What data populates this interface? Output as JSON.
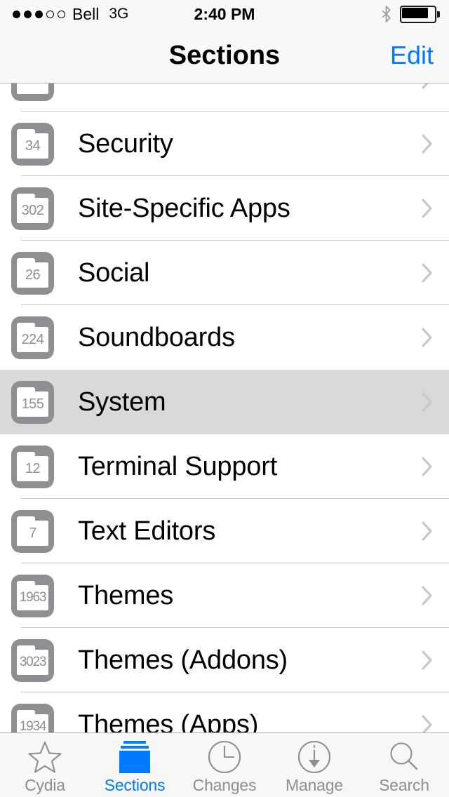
{
  "status_bar": {
    "signal_dots_filled": 3,
    "signal_dots_total": 5,
    "carrier": "Bell",
    "network": "3G",
    "time": "2:40 PM",
    "bluetooth_icon": "bluetooth-icon",
    "battery_icon": "battery-icon",
    "battery_level_percent": 80
  },
  "nav_bar": {
    "title": "Sections",
    "edit_label": "Edit",
    "accent_color": "#007aff"
  },
  "list": {
    "partial_top_row": {
      "label": "",
      "count": ""
    },
    "rows": [
      {
        "count": "34",
        "label": "Security",
        "selected": false
      },
      {
        "count": "302",
        "label": "Site-Specific Apps",
        "selected": false
      },
      {
        "count": "26",
        "label": "Social",
        "selected": false
      },
      {
        "count": "224",
        "label": "Soundboards",
        "selected": false
      },
      {
        "count": "155",
        "label": "System",
        "selected": true
      },
      {
        "count": "12",
        "label": "Terminal Support",
        "selected": false
      },
      {
        "count": "7",
        "label": "Text Editors",
        "selected": false
      },
      {
        "count": "1963",
        "label": "Themes",
        "selected": false
      },
      {
        "count": "3023",
        "label": "Themes (Addons)",
        "selected": false
      },
      {
        "count": "1934",
        "label": "Themes (Apps)",
        "selected": false
      }
    ],
    "disclosure_icon": "chevron-right-icon",
    "selected_row_color": "#d9d9d9",
    "separator_color": "#c8c8c8"
  },
  "tab_bar": {
    "active_color": "#007aff",
    "inactive_color": "#8e8e93",
    "tabs": [
      {
        "label": "Cydia",
        "icon": "star-icon",
        "active": false
      },
      {
        "label": "Sections",
        "icon": "folder-stack-icon",
        "active": true
      },
      {
        "label": "Changes",
        "icon": "clock-icon",
        "active": false
      },
      {
        "label": "Manage",
        "icon": "download-circle-icon",
        "active": false
      },
      {
        "label": "Search",
        "icon": "magnifier-icon",
        "active": false
      }
    ]
  }
}
